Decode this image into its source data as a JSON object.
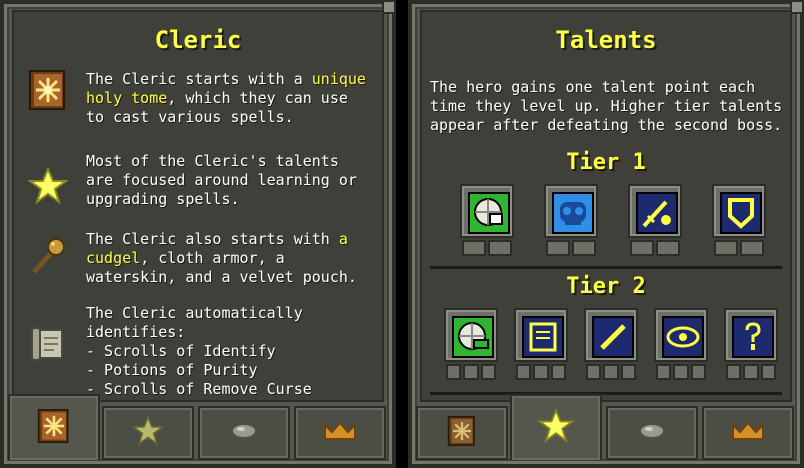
{
  "left_panel": {
    "title": "Cleric",
    "entries": [
      {
        "icon": "holy-tome-icon",
        "text_before": "The Cleric starts with a ",
        "highlight": "unique holy tome",
        "text_after": ", which they can use to cast various spells."
      },
      {
        "icon": "star-icon",
        "text_before": "Most of the Cleric's talents are focused around learning or upgrading spells.",
        "highlight": "",
        "text_after": ""
      },
      {
        "icon": "cudgel-icon",
        "text_before": "The Cleric also starts with ",
        "highlight": "a cudgel",
        "text_after": ", cloth armor, a waterskin, and a velvet pouch."
      },
      {
        "icon": "scroll-icon",
        "text_before": "The Cleric automatically identifies:\n- Scrolls of Identify\n- Potions of Purity\n- Scrolls of Remove Curse",
        "highlight": "",
        "text_after": ""
      }
    ],
    "tabs": [
      {
        "icon": "holy-tome-icon",
        "active": true
      },
      {
        "icon": "star-icon",
        "active": false
      },
      {
        "icon": "gem-icon",
        "active": false
      },
      {
        "icon": "crown-icon",
        "active": false
      }
    ]
  },
  "right_panel": {
    "title": "Talents",
    "intro": "The hero gains one talent point each time they level up. Higher tier talents appear after defeating the second boss.",
    "tiers": [
      {
        "label": "Tier 1",
        "talents": [
          {
            "icon": "food-sense-icon",
            "bg": "#2fb52f",
            "pips": 2
          },
          {
            "icon": "skull-icon",
            "bg": "#2f8fe8",
            "pips": 2
          },
          {
            "icon": "cudgel-strike-icon",
            "bg": "#1e2a6e",
            "pips": 2
          },
          {
            "icon": "shield-icon",
            "bg": "#1e2a6e",
            "pips": 2
          }
        ]
      },
      {
        "label": "Tier 2",
        "talents": [
          {
            "icon": "food-heal-icon",
            "bg": "#2fb52f",
            "pips": 3
          },
          {
            "icon": "scroll-talent-icon",
            "bg": "#1e2a6e",
            "pips": 3
          },
          {
            "icon": "wand-icon",
            "bg": "#1e2a6e",
            "pips": 3
          },
          {
            "icon": "eye-icon",
            "bg": "#1e2a6e",
            "pips": 3
          },
          {
            "icon": "question-key-icon",
            "bg": "#1e2a6e",
            "pips": 3
          }
        ]
      }
    ],
    "tabs": [
      {
        "icon": "holy-tome-icon",
        "active": false
      },
      {
        "icon": "star-icon",
        "active": true
      },
      {
        "icon": "gem-icon",
        "active": false
      },
      {
        "icon": "crown-icon",
        "active": false
      }
    ]
  },
  "colors": {
    "highlight": "#ffff44",
    "text": "#ffffff",
    "panel": "#55564d"
  }
}
